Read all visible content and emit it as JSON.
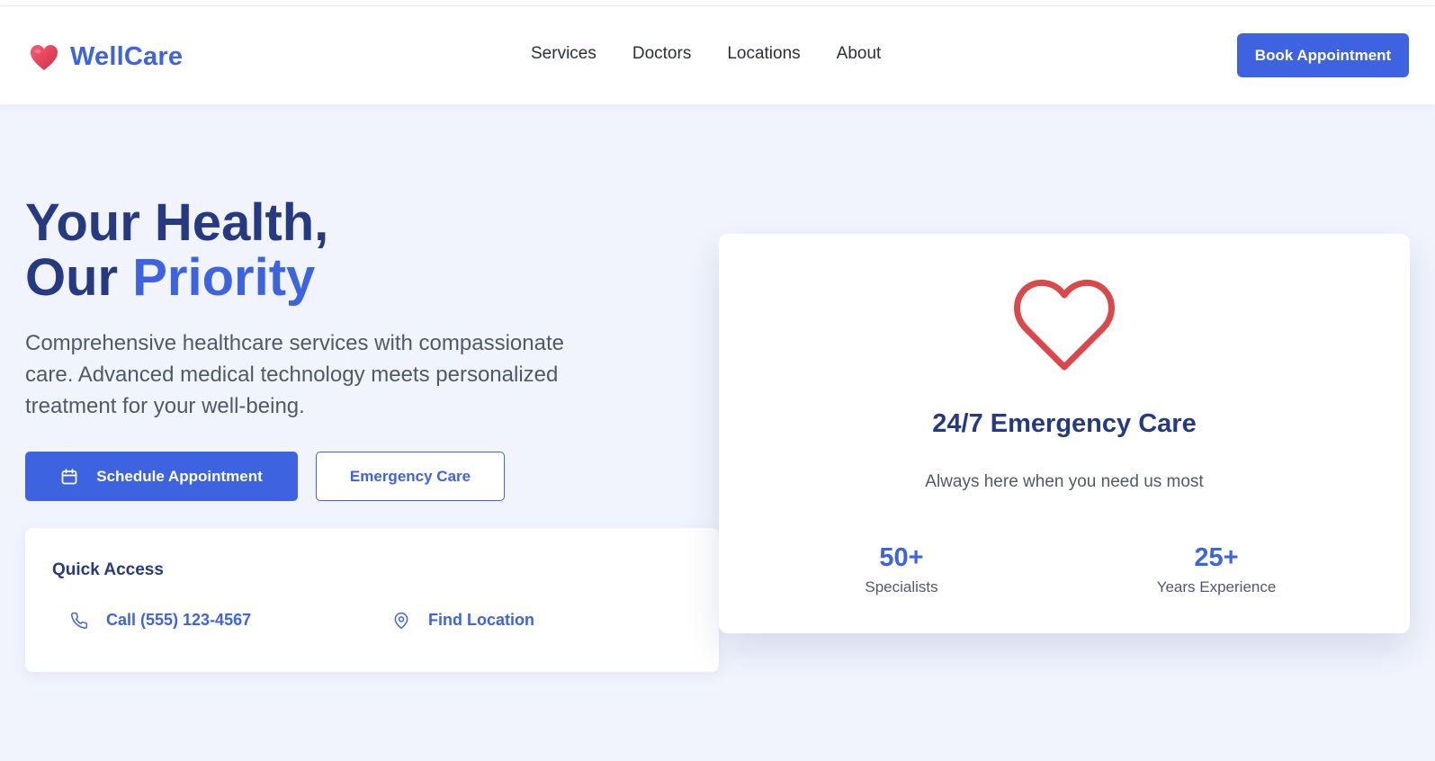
{
  "brand": {
    "name": "WellCare",
    "icon": "heart-icon",
    "color": "#3d63e0"
  },
  "nav": {
    "items": [
      "Services",
      "Doctors",
      "Locations",
      "About"
    ]
  },
  "header": {
    "book_label": "Book Appointment"
  },
  "hero": {
    "title_line1": "Your Health,",
    "title_line2_prefix": "Our ",
    "title_line2_accent": "Priority",
    "description": "Comprehensive healthcare services with compassionate care. Advanced medical technology meets personalized treatment for your well-being.",
    "schedule_label": "Schedule Appointment",
    "schedule_icon": "calendar-icon",
    "emergency_label": "Emergency Care"
  },
  "quick_access": {
    "title": "Quick Access",
    "call_label": "Call (555) 123-4567",
    "call_icon": "phone-icon",
    "location_label": "Find Location",
    "location_icon": "map-pin-icon"
  },
  "emergency_card": {
    "icon": "heart-outline-icon",
    "title": "24/7 Emergency Care",
    "subtitle": "Always here when you need us most",
    "stats": [
      {
        "value": "50+",
        "label": "Specialists"
      },
      {
        "value": "25+",
        "label": "Years Experience"
      }
    ]
  },
  "colors": {
    "primary": "#3d63e0",
    "heading": "#253a80",
    "heart_red": "#d9484a",
    "background": "#f1f4fd"
  }
}
